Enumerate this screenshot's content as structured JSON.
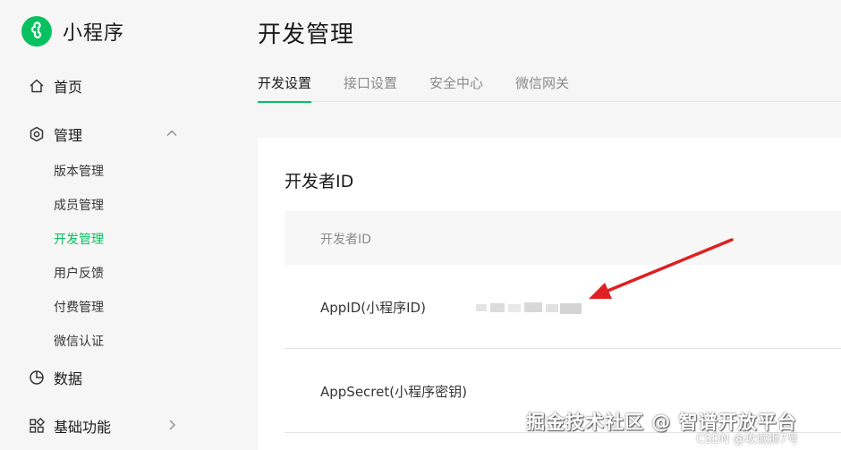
{
  "sidebar": {
    "brand": "小程序",
    "items": [
      {
        "label": "首页",
        "icon": "home-icon"
      },
      {
        "label": "管理",
        "icon": "hexagon-gear-icon",
        "expanded": true
      },
      {
        "label": "数据",
        "icon": "pie-chart-icon"
      },
      {
        "label": "基础功能",
        "icon": "grid-icon"
      }
    ],
    "sub_items": [
      {
        "label": "版本管理"
      },
      {
        "label": "成员管理"
      },
      {
        "label": "开发管理",
        "active": true
      },
      {
        "label": "用户反馈"
      },
      {
        "label": "付费管理"
      },
      {
        "label": "微信认证"
      }
    ]
  },
  "main": {
    "title": "开发管理",
    "tabs": [
      {
        "label": "开发设置",
        "active": true
      },
      {
        "label": "接口设置"
      },
      {
        "label": "安全中心"
      },
      {
        "label": "微信网关"
      }
    ],
    "section_title": "开发者ID",
    "table_header": "开发者ID",
    "rows": [
      {
        "label": "AppID(小程序ID)"
      },
      {
        "label": "AppSecret(小程序密钥)"
      }
    ]
  },
  "watermark": {
    "main": "掘金技术社区 @ 智谱开放平台",
    "sub": "CSDN @攻城狮7号"
  },
  "colors": {
    "accent": "#07c160",
    "annotation_arrow": "#e02020"
  }
}
